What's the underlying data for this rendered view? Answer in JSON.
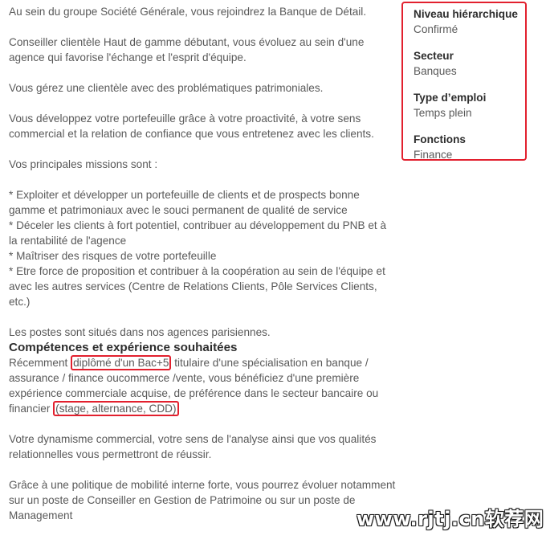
{
  "intro": {
    "p1": "Au sein du groupe Société Générale, vous rejoindrez la Banque de Détail.",
    "p2": "Conseiller clientèle Haut de gamme débutant, vous évoluez au sein d'une agence qui favorise l'échange et l'esprit d'équipe.",
    "p3": "Vous gérez une clientèle avec des problématiques patrimoniales.",
    "p4": "Vous développez votre portefeuille grâce à votre proactivité, à votre sens commercial et la relation de confiance que vous entretenez avec les clients.",
    "p5": "Vos principales missions sont :"
  },
  "missions": [
    "* Exploiter et développer un portefeuille de clients et de prospects bonne gamme et patrimoniaux avec le souci permanent de qualité de service",
    "* Déceler les clients à fort potentiel, contribuer au développement du PNB et à la rentabilité de l'agence",
    "* Maîtriser des risques de votre portefeuille",
    "* Etre force de proposition et contribuer à la coopération au sein de l'équipe et avec les autres services (Centre de Relations Clients, Pôle Services Clients, etc.)"
  ],
  "location": "Les postes sont situés dans nos agences parisiennes.",
  "competences": {
    "heading": "Compétences et expérience souhaitées",
    "part1": "Récemment",
    "highlight1": "diplômé d'un Bac+5",
    "part2": "titulaire d'une spécialisation en banque / assurance / finance oucommerce /vente, vous bénéficiez d'une première expérience commerciale acquise, de préférence dans le secteur bancaire ou financier",
    "highlight2": "(stage, alternance, CDD)",
    "p2": "Votre dynamisme commercial, votre sens de l'analyse ainsi que vos qualités relationnelles vous permettront de réussir.",
    "p3": "Grâce à une politique de mobilité interne forte, vous pourrez évoluer notamment sur un poste de Conseiller en Gestion de Patrimoine ou sur un poste de Management"
  },
  "sidebar": {
    "level_label": "Niveau hiérarchique",
    "level_value": "Confirmé",
    "sector_label": "Secteur",
    "sector_value": "Banques",
    "type_label": "Type d’emploi",
    "type_value": "Temps plein",
    "functions_label": "Fonctions",
    "functions_value": "Finance"
  },
  "watermark": "www.rjtj.cn软荐网"
}
